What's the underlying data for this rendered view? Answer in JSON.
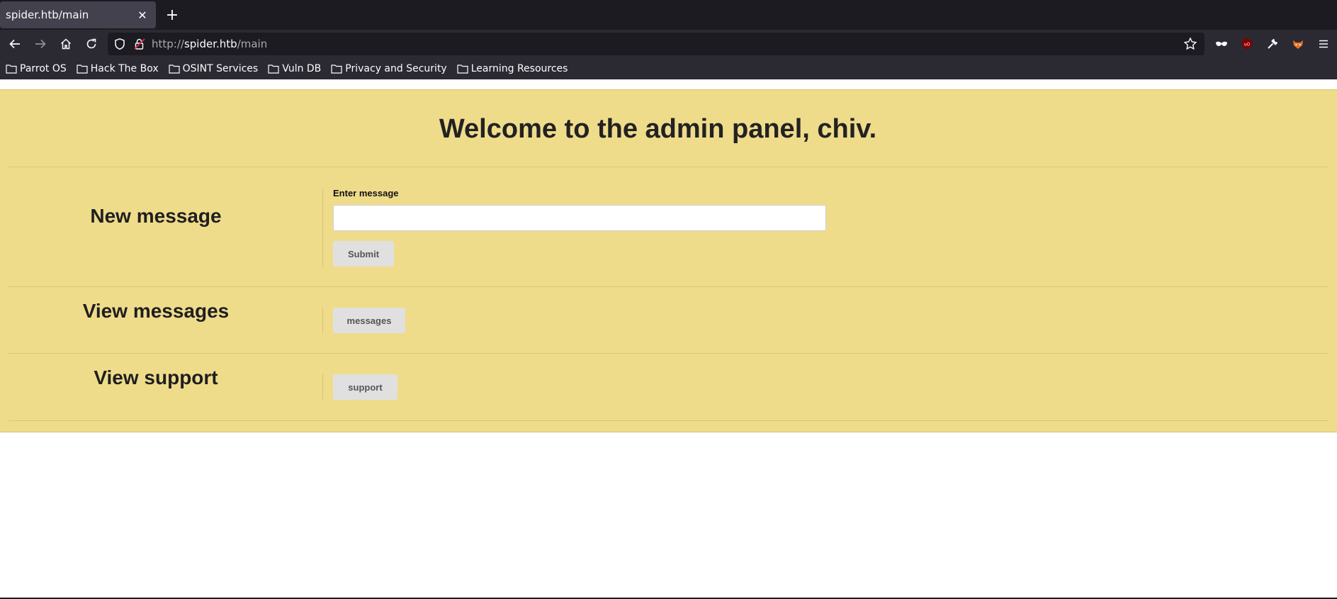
{
  "browser": {
    "tab_title": "spider.htb/main",
    "tab_close": "✕",
    "new_tab": "+",
    "url_scheme": "http://",
    "url_host": "spider.htb",
    "url_path": "/main"
  },
  "bookmarks": [
    {
      "label": "Parrot OS"
    },
    {
      "label": "Hack The Box"
    },
    {
      "label": "OSINT Services"
    },
    {
      "label": "Vuln DB"
    },
    {
      "label": "Privacy and Security"
    },
    {
      "label": "Learning Resources"
    }
  ],
  "page": {
    "welcome": "Welcome to the admin panel, chiv.",
    "new_message_title": "New message",
    "enter_message_label": "Enter message",
    "message_value": "",
    "submit_label": "Submit",
    "view_messages_title": "View messages",
    "messages_button": "messages",
    "view_support_title": "View support",
    "support_button": "support"
  },
  "colors": {
    "panel_bg": "#efdc8b",
    "chrome_dark": "#1c1b22",
    "toolbar": "#2b2a33"
  }
}
